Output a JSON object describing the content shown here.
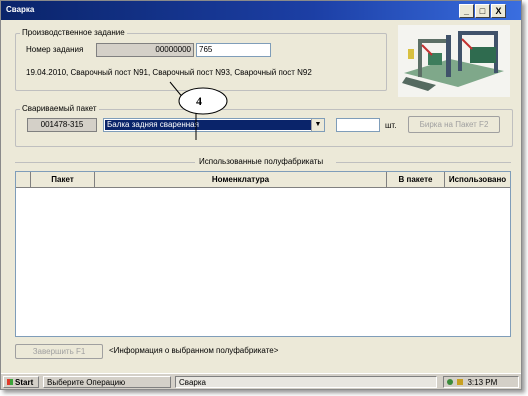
{
  "window": {
    "title": "Сварка",
    "minimize": "_",
    "maximize": "□",
    "close": "X"
  },
  "task_group": {
    "legend": "Производственное задание",
    "number_label": "Номер задания",
    "number_value": "00000000",
    "number_suffix": "765",
    "info": "19.04.2010, Сварочный пост N91, Сварочный пост N93, Сварочный пост N92"
  },
  "callout": {
    "text": "4"
  },
  "package_group": {
    "legend": "Свариваемый пакет",
    "code": "001478-315",
    "selected": "Балка задняя сваренная",
    "qty": "",
    "unit": "шт.",
    "tag_button": "Бирка на Пакет   F2"
  },
  "materials": {
    "title": "Использованные полуфабрикаты",
    "columns": [
      "Пакет",
      "Номенклатура",
      "В пакете",
      "Использовано"
    ]
  },
  "footer": {
    "finish_button": "Завершить      F1",
    "info": "<Информация о выбранном полуфабрикате>"
  },
  "taskbar": {
    "start": "Start",
    "operation": "Выберите Операцию",
    "app": "Сварка",
    "time": "3:13 PM"
  },
  "colors": {
    "title_bar": "#0a246a",
    "selection": "#0a246a",
    "window_bg": "#ece9d8"
  }
}
